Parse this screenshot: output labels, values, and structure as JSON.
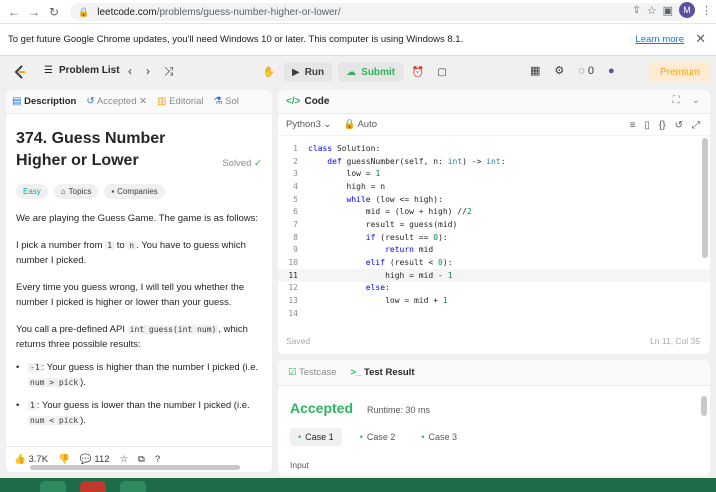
{
  "browser": {
    "url_host": "leetcode.com",
    "url_path": "/problems/guess-number-higher-or-lower/",
    "avatar_letter": "M",
    "warning_text": "To get future Google Chrome updates, you'll need Windows 10 or later. This computer is using Windows 8.1.",
    "learn_more": "Learn more"
  },
  "nav": {
    "problem_list": "Problem List",
    "run": "Run",
    "submit": "Submit",
    "coins": "0",
    "premium": "Premium"
  },
  "left": {
    "tabs": [
      "Description",
      "Accepted",
      "Editorial",
      "Sol"
    ],
    "title": "374. Guess Number Higher or Lower",
    "solved": "Solved",
    "chips": [
      "Easy",
      "Topics",
      "Companies"
    ],
    "p1": "We are playing the Guess Game. The game is as follows:",
    "p2_a": "I pick a number from ",
    "p2_code1": "1",
    "p2_b": " to ",
    "p2_code2": "n",
    "p2_c": ". You have to guess which number I picked.",
    "p3": "Every time you guess wrong, I will tell you whether the number I picked is higher or lower than your guess.",
    "p4_a": "You call a pre-defined API ",
    "p4_code": "int guess(int num)",
    "p4_b": ", which returns three possible results:",
    "b1_code": "-1",
    "b1_text": ": Your guess is higher than the number I picked (i.e. ",
    "b1_code2": "num > pick",
    "b1_end": ").",
    "b2_code": "1",
    "b2_text": ": Your guess is lower than the number I picked (i.e. ",
    "b2_code2": "num < pick",
    "b2_end": ").",
    "likes": "3.7K",
    "comments": "112"
  },
  "code": {
    "header": "Code",
    "language": "Python3",
    "auto": "Auto",
    "lines": [
      "class Solution:",
      "    def guessNumber(self, n: int) -> int:",
      "        low = 1",
      "        high = n",
      "        while (low <= high):",
      "            mid = (low + high) //2",
      "            result = guess(mid)",
      "            if (result == 0):",
      "                return mid",
      "            elif (result < 0):",
      "                high = mid - 1",
      "            else:",
      "                low = mid + 1",
      ""
    ],
    "line_numbers": [
      "1",
      "2",
      "3",
      "4",
      "5",
      "6",
      "7",
      "8",
      "9",
      "10",
      "11",
      "12",
      "13",
      "14"
    ],
    "status": "Saved",
    "position": "Ln 11, Col 35"
  },
  "result": {
    "tabs": [
      "Testcase",
      "Test Result"
    ],
    "verdict": "Accepted",
    "runtime": "Runtime: 30 ms",
    "cases": [
      "Case 1",
      "Case 2",
      "Case 3"
    ],
    "input_label": "Input"
  }
}
